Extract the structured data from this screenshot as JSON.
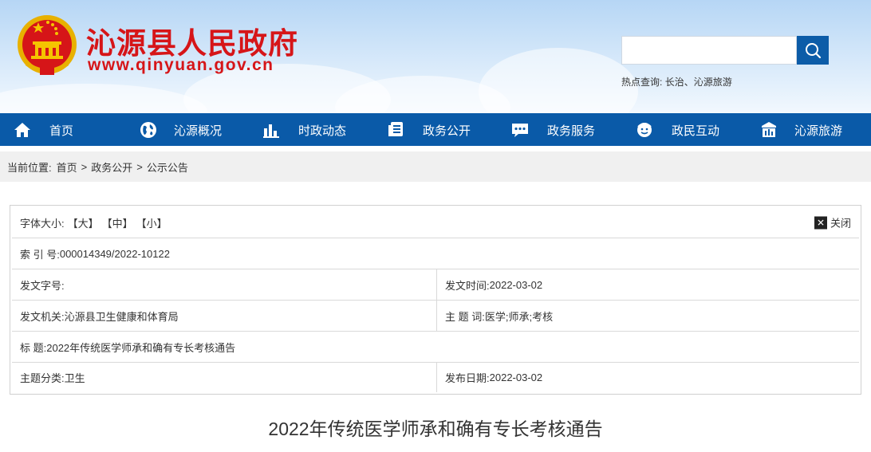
{
  "header": {
    "site_name": "沁源县人民政府",
    "site_url": "www.qinyuan.gov.cn",
    "search": {
      "placeholder": ""
    },
    "hot_search": {
      "label": "热点查询:",
      "links": [
        "长治",
        "沁源旅游"
      ],
      "separator": "、"
    }
  },
  "nav": {
    "items": [
      {
        "label": "首页",
        "icon": "home-icon"
      },
      {
        "label": "沁源概况",
        "icon": "globe-icon"
      },
      {
        "label": "时政动态",
        "icon": "bar-chart-icon"
      },
      {
        "label": "政务公开",
        "icon": "document-icon"
      },
      {
        "label": "政务服务",
        "icon": "chat-icon"
      },
      {
        "label": "政民互动",
        "icon": "people-icon"
      },
      {
        "label": "沁源旅游",
        "icon": "landmark-icon"
      }
    ]
  },
  "breadcrumb": {
    "label": "当前位置:",
    "items": [
      "首页",
      "政务公开",
      "公示公告"
    ],
    "separator": ">"
  },
  "info": {
    "font_size_label": "字体大小:",
    "font_size_options": [
      "【大】",
      "【中】",
      "【小】"
    ],
    "close_label": "关闭",
    "index_label": "索 引 号:",
    "index_value": "000014349/2022-10122",
    "doc_no_label": "发文字号:",
    "doc_no_value": "",
    "issue_time_label": "发文时间:",
    "issue_time_value": "2022-03-02",
    "issuer_label": "发文机关:",
    "issuer_value": "沁源县卫生健康和体育局",
    "subject_words_label": "主 题 词:",
    "subject_words_value": "医学;师承;考核",
    "title_label": "标 题:",
    "title_value": "2022年传统医学师承和确有专长考核通告",
    "category_label": "主题分类:",
    "category_value": "卫生",
    "publish_date_label": "发布日期:",
    "publish_date_value": "2022-03-02"
  },
  "article": {
    "title": "2022年传统医学师承和确有专长考核通告"
  },
  "colors": {
    "brand_red": "#d61518",
    "nav_blue": "#0a5aa8",
    "search_button_blue": "#0c5ca8"
  }
}
